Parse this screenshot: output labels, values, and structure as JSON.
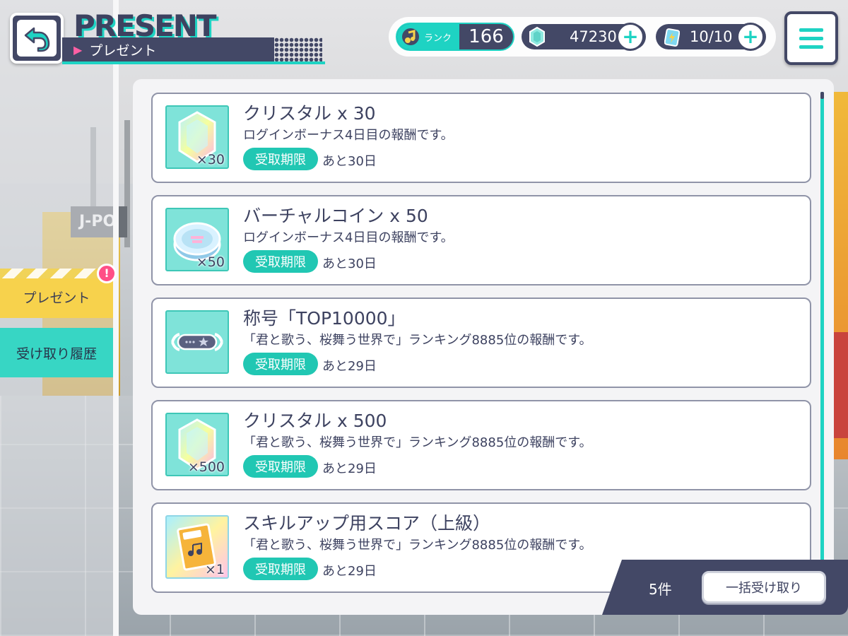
{
  "header": {
    "title": "PRESENT",
    "subtitle": "プレゼント"
  },
  "status": {
    "rank_label": "ランク",
    "rank_value": "166",
    "crystals": "47230",
    "stamina": "10/10"
  },
  "sidebar": {
    "items": [
      {
        "label": "プレゼント",
        "active": true
      },
      {
        "label": "受け取り履歴",
        "active": false
      }
    ]
  },
  "presents": [
    {
      "name": "クリスタル x 30",
      "desc": "ログインボーナス4日目の報酬です。",
      "deadline_label": "受取期限",
      "remaining": "あと30日",
      "icon": "crystal-icon",
      "count": "×30"
    },
    {
      "name": "バーチャルコイン x 50",
      "desc": "ログインボーナス4日目の報酬です。",
      "deadline_label": "受取期限",
      "remaining": "あと30日",
      "icon": "virtual-coin-icon",
      "count": "×50"
    },
    {
      "name": "称号「TOP10000」",
      "desc": "「君と歌う、桜舞う世界で」ランキング8885位の報酬です。",
      "deadline_label": "受取期限",
      "remaining": "あと29日",
      "icon": "title-plate-icon",
      "count": ""
    },
    {
      "name": "クリスタル x 500",
      "desc": "「君と歌う、桜舞う世界で」ランキング8885位の報酬です。",
      "deadline_label": "受取期限",
      "remaining": "あと29日",
      "icon": "crystal-icon",
      "count": "×500"
    },
    {
      "name": "スキルアップ用スコア（上級）",
      "desc": "「君と歌う、桜舞う世界で」ランキング8885位の報酬です。",
      "deadline_label": "受取期限",
      "remaining": "あと29日",
      "icon": "skill-score-icon",
      "count": "×1"
    }
  ],
  "footer": {
    "count": "5件",
    "claim_all": "一括受け取り"
  },
  "background": {
    "sign": "J-PO"
  },
  "colors": {
    "accent": "#1ed3c3",
    "navy": "#434866",
    "yellow": "#f7d24c",
    "pink": "#ff5fa4"
  }
}
